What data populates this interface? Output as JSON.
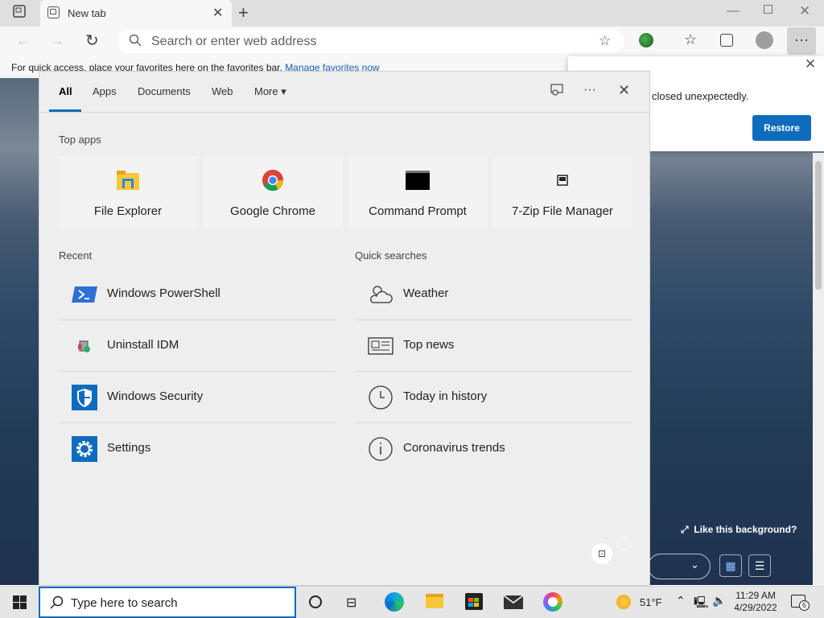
{
  "browser": {
    "tab_title": "New tab",
    "address_placeholder": "Search or enter web address",
    "favbar_text": "For quick access, place your favorites here on the favorites bar.",
    "favbar_link": "Manage favorites now"
  },
  "restore_popup": {
    "message": "closed unexpectedly.",
    "button": "Restore"
  },
  "background": {
    "like_text": "Like this background?"
  },
  "search_panel": {
    "tabs": [
      "All",
      "Apps",
      "Documents",
      "Web",
      "More"
    ],
    "top_apps_heading": "Top apps",
    "top_apps": [
      "File Explorer",
      "Google Chrome",
      "Command Prompt",
      "7-Zip File Manager"
    ],
    "recent_heading": "Recent",
    "recent": [
      "Windows PowerShell",
      "Uninstall IDM",
      "Windows Security",
      "Settings"
    ],
    "quick_heading": "Quick searches",
    "quick": [
      "Weather",
      "Top news",
      "Today in history",
      "Coronavirus trends"
    ]
  },
  "taskbar": {
    "search_placeholder": "Type here to search",
    "weather": "51°F",
    "time": "11:29 AM",
    "date": "4/29/2022",
    "notification_count": "6"
  },
  "colors": {
    "accent": "#0f6cbd"
  }
}
